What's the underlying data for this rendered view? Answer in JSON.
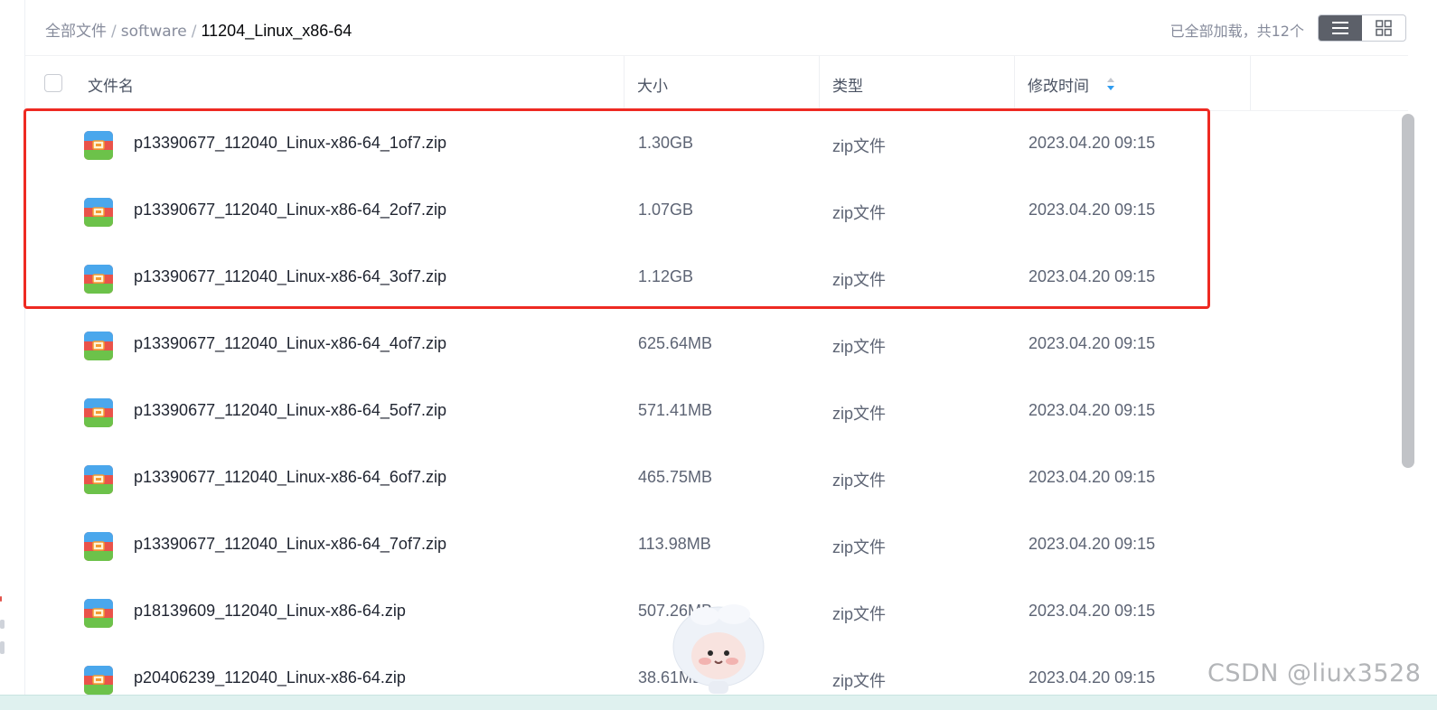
{
  "breadcrumb": {
    "root": "全部文件",
    "folder": "software",
    "current": "11204_Linux_x86-64",
    "separator": "/"
  },
  "status": {
    "load_text": "已全部加载，共12个"
  },
  "view_toggle": {
    "list_icon": "list-view-icon",
    "grid_icon": "grid-view-icon",
    "active": "list"
  },
  "columns": {
    "name": "文件名",
    "size": "大小",
    "type": "类型",
    "modified": "修改时间"
  },
  "files": [
    {
      "name": "p13390677_112040_Linux-x86-64_1of7.zip",
      "size": "1.30GB",
      "type": "zip文件",
      "modified": "2023.04.20 09:15"
    },
    {
      "name": "p13390677_112040_Linux-x86-64_2of7.zip",
      "size": "1.07GB",
      "type": "zip文件",
      "modified": "2023.04.20 09:15"
    },
    {
      "name": "p13390677_112040_Linux-x86-64_3of7.zip",
      "size": "1.12GB",
      "type": "zip文件",
      "modified": "2023.04.20 09:15"
    },
    {
      "name": "p13390677_112040_Linux-x86-64_4of7.zip",
      "size": "625.64MB",
      "type": "zip文件",
      "modified": "2023.04.20 09:15"
    },
    {
      "name": "p13390677_112040_Linux-x86-64_5of7.zip",
      "size": "571.41MB",
      "type": "zip文件",
      "modified": "2023.04.20 09:15"
    },
    {
      "name": "p13390677_112040_Linux-x86-64_6of7.zip",
      "size": "465.75MB",
      "type": "zip文件",
      "modified": "2023.04.20 09:15"
    },
    {
      "name": "p13390677_112040_Linux-x86-64_7of7.zip",
      "size": "113.98MB",
      "type": "zip文件",
      "modified": "2023.04.20 09:15"
    },
    {
      "name": "p18139609_112040_Linux-x86-64.zip",
      "size": "507.26MB",
      "type": "zip文件",
      "modified": "2023.04.20 09:15"
    },
    {
      "name": "p20406239_112040_Linux-x86-64.zip",
      "size": "38.61MB",
      "type": "zip文件",
      "modified": "2023.04.20 09:15"
    }
  ],
  "file_icon": "zip-archive-icon",
  "highlight_color": "#ee2a22",
  "watermark": "CSDN @liux3528"
}
